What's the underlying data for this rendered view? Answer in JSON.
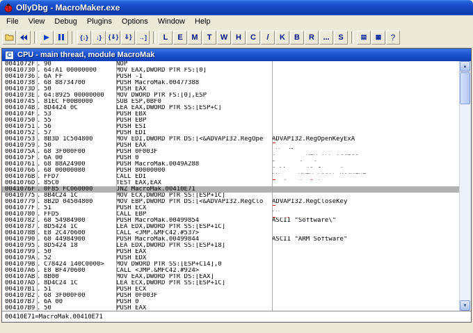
{
  "window": {
    "title": "OllyDbg - MacroMaker.exe"
  },
  "menu": {
    "items": [
      {
        "label": "File",
        "name": "file"
      },
      {
        "label": "View",
        "name": "view"
      },
      {
        "label": "Debug",
        "name": "debug"
      },
      {
        "label": "Plugins",
        "name": "plugins"
      },
      {
        "label": "Options",
        "name": "options"
      },
      {
        "label": "Window",
        "name": "window"
      },
      {
        "label": "Help",
        "name": "help"
      }
    ]
  },
  "toolbar": {
    "groups": [
      {
        "buttons": [
          {
            "name": "open-file",
            "icon": "folder-icon"
          },
          {
            "name": "restart",
            "icon": "restart-icon"
          }
        ]
      },
      {
        "buttons": [
          {
            "name": "run",
            "icon": "run-icon"
          },
          {
            "name": "pause",
            "icon": "pause-icon"
          }
        ]
      },
      {
        "buttons": [
          {
            "name": "step-into",
            "icon": "step-into-icon"
          },
          {
            "name": "step-over",
            "icon": "step-over-icon"
          },
          {
            "name": "animate-into",
            "icon": "animate-into-icon"
          },
          {
            "name": "animate-over",
            "icon": "animate-over-icon"
          },
          {
            "name": "execute-till-return",
            "icon": "execute-till-return-icon"
          }
        ]
      },
      {
        "buttons": [
          {
            "label": "L",
            "name": "log-window"
          },
          {
            "label": "E",
            "name": "executable-modules"
          },
          {
            "label": "M",
            "name": "memory-map"
          },
          {
            "label": "T",
            "name": "threads"
          },
          {
            "label": "W",
            "name": "windows"
          },
          {
            "label": "H",
            "name": "handles"
          },
          {
            "label": "C",
            "name": "cpu"
          },
          {
            "label": "/",
            "name": "patches"
          },
          {
            "label": "K",
            "name": "call-stack"
          },
          {
            "label": "B",
            "name": "breakpoints"
          },
          {
            "label": "R",
            "name": "references"
          },
          {
            "label": "...",
            "name": "run-trace"
          },
          {
            "label": "S",
            "name": "source"
          }
        ]
      },
      {
        "buttons": [
          {
            "name": "options-dialog",
            "icon": "options-icon"
          },
          {
            "name": "appearance",
            "icon": "appearance-icon"
          },
          {
            "label": "?",
            "name": "help",
            "icon": "help-icon"
          }
        ]
      }
    ]
  },
  "cpu_window": {
    "title": "CPU - main thread, module MacroMak",
    "info_line": "00410E71=MacroMak.00410E71"
  },
  "colors": {
    "titlebar_blue": "#1d54d2",
    "comment_red": "#e10000",
    "selection_gray": "#b2b2b2",
    "chrome_bg": "#ece9d8"
  },
  "disassembly": {
    "rows": [
      {
        "addr": "0041072F",
        "mark": ".",
        "bytes": "90",
        "disasm": "NOP",
        "comment": "",
        "bracket": "",
        "red": false,
        "selected": false
      },
      {
        "addr": "00410730",
        "mark": ".",
        "bytes": "64:A1 00000000",
        "disasm": "MOV EAX,DWORD PTR FS:[0]",
        "comment": "",
        "bracket": "",
        "red": false,
        "selected": false
      },
      {
        "addr": "00410736",
        "mark": ".",
        "bytes": "6A FF",
        "disasm": "PUSH -1",
        "comment": "",
        "bracket": "",
        "red": false,
        "selected": false
      },
      {
        "addr": "00410738",
        "mark": ".",
        "bytes": "68 88734700",
        "disasm": "PUSH MacroMak.00477388",
        "comment": "",
        "bracket": "",
        "red": false,
        "selected": false
      },
      {
        "addr": "0041073D",
        "mark": ".",
        "bytes": "50",
        "disasm": "PUSH EAX",
        "comment": "",
        "bracket": "",
        "red": false,
        "selected": false
      },
      {
        "addr": "0041073E",
        "mark": ".",
        "bytes": "64:8925 00000000",
        "disasm": "MOV DWORD PTR FS:[0],ESP",
        "comment": "",
        "bracket": "",
        "red": false,
        "selected": false
      },
      {
        "addr": "00410745",
        "mark": ".",
        "bytes": "81EC F00B0000",
        "disasm": "SUB ESP,0BF0",
        "comment": "",
        "bracket": "",
        "red": false,
        "selected": false
      },
      {
        "addr": "0041074B",
        "mark": ".",
        "bytes": "8D4424 0C",
        "disasm": "LEA EAX,DWORD PTR SS:[ESP+C]",
        "comment": "",
        "bracket": "",
        "red": false,
        "selected": false
      },
      {
        "addr": "0041074F",
        "mark": ".",
        "bytes": "53",
        "disasm": "PUSH EBX",
        "comment": "",
        "bracket": "",
        "red": false,
        "selected": false
      },
      {
        "addr": "00410750",
        "mark": ".",
        "bytes": "55",
        "disasm": "PUSH EBP",
        "comment": "",
        "bracket": "",
        "red": false,
        "selected": false
      },
      {
        "addr": "00410751",
        "mark": ".",
        "bytes": "56",
        "disasm": "PUSH ESI",
        "comment": "",
        "bracket": "",
        "red": false,
        "selected": false
      },
      {
        "addr": "00410752",
        "mark": ".",
        "bytes": "57",
        "disasm": "PUSH EDI",
        "comment": "",
        "bracket": "",
        "red": false,
        "selected": false
      },
      {
        "addr": "00410753",
        "mark": ".",
        "bytes": "8B3D 1C504800",
        "disasm": "MOV EDI,DWORD PTR DS:[<&ADVAPI32.RegOpe",
        "comment": "ADVAPI32.RegOpenKeyExA",
        "bracket": "",
        "red": false,
        "selected": false
      },
      {
        "addr": "00410759",
        "mark": ".",
        "bytes": "50",
        "disasm": "PUSH EAX",
        "comment": "pHandle",
        "bracket": "top",
        "red": false,
        "selected": false
      },
      {
        "addr": "0041075A",
        "mark": ".",
        "bytes": "68 3F000F00",
        "disasm": "PUSH 0F003F",
        "comment": "Access = KEY_ALL_ACCESS",
        "bracket": "mid",
        "red": false,
        "selected": false
      },
      {
        "addr": "0041075F",
        "mark": ".",
        "bytes": "6A 00",
        "disasm": "PUSH 0",
        "comment": "Reserved = 0",
        "bracket": "mid",
        "red": false,
        "selected": false
      },
      {
        "addr": "00410761",
        "mark": ".",
        "bytes": "68 88A24900",
        "disasm": "PUSH MacroMak.0049A288",
        "comment": "Subkey = \"Software\"",
        "bracket": "mid",
        "red": false,
        "selected": false
      },
      {
        "addr": "00410766",
        "mark": ".",
        "bytes": "68 00000080",
        "disasm": "PUSH 80000000",
        "comment": "hKey = HKEY_LOCAL_MACHINE",
        "bracket": "mid",
        "red": false,
        "selected": false
      },
      {
        "addr": "0041076B",
        "mark": ".",
        "bytes": "FFD7",
        "disasm": "CALL EDI",
        "comment": "RegOpenKeyExA",
        "bracket": "bottom",
        "red": true,
        "selected": false
      },
      {
        "addr": "0041076D",
        "mark": ".",
        "bytes": "85C0",
        "disasm": "TEST EAX,EAX",
        "comment": "",
        "bracket": "",
        "red": false,
        "selected": false
      },
      {
        "addr": "0041076F",
        "mark": ".",
        "bytes": "0F85 FC060000",
        "disasm": "JNZ MacroMak.00410E71",
        "comment": "",
        "bracket": "",
        "red": false,
        "selected": true
      },
      {
        "addr": "00410775",
        "mark": ".",
        "bytes": "8B4C24 1C",
        "disasm": "MOV ECX,DWORD PTR SS:[ESP+1C]",
        "comment": "",
        "bracket": "",
        "red": false,
        "selected": false
      },
      {
        "addr": "00410779",
        "mark": ".",
        "bytes": "8B2D 04504800",
        "disasm": "MOV EBP,DWORD PTR DS:[<&ADVAPI32.RegClo",
        "comment": "ADVAPI32.RegCloseKey",
        "bracket": "",
        "red": false,
        "selected": false
      },
      {
        "addr": "0041077F",
        "mark": ".",
        "bytes": "51",
        "disasm": "PUSH ECX",
        "comment": "hKey",
        "bracket": "top",
        "red": false,
        "selected": false
      },
      {
        "addr": "00410780",
        "mark": ".",
        "bytes": "FFD5",
        "disasm": "CALL EBP",
        "comment": "RegCloseKey",
        "bracket": "bottom",
        "red": true,
        "selected": false
      },
      {
        "addr": "00410782",
        "mark": ".",
        "bytes": "68 54984900",
        "disasm": "PUSH MacroMak.00499854",
        "comment": "ASCII \"Software\\\"",
        "bracket": "",
        "red": false,
        "selected": false
      },
      {
        "addr": "00410787",
        "mark": ".",
        "bytes": "8D5424 1C",
        "disasm": "LEA EDX,DWORD PTR SS:[ESP+1C]",
        "comment": "",
        "bracket": "",
        "red": false,
        "selected": false
      },
      {
        "addr": "0041078B",
        "mark": ".",
        "bytes": "E8 2C470600",
        "disasm": "CALL <JMP.&MFC42.#537>",
        "comment": "",
        "bracket": "",
        "red": false,
        "selected": false
      },
      {
        "addr": "00410790",
        "mark": ".",
        "bytes": "68 44984900",
        "disasm": "PUSH MacroMak.00499844",
        "comment": "ASCII \"ARM Software\"",
        "bracket": "",
        "red": false,
        "selected": false
      },
      {
        "addr": "00410795",
        "mark": ".",
        "bytes": "8D5424 18",
        "disasm": "LEA EDX,DWORD PTR SS:[ESP+18]",
        "comment": "",
        "bracket": "",
        "red": false,
        "selected": false
      },
      {
        "addr": "00410799",
        "mark": ".",
        "bytes": "50",
        "disasm": "PUSH EAX",
        "comment": "",
        "bracket": "",
        "red": false,
        "selected": false
      },
      {
        "addr": "0041079A",
        "mark": ".",
        "bytes": "52",
        "disasm": "PUSH EDX",
        "comment": "",
        "bracket": "",
        "red": false,
        "selected": false
      },
      {
        "addr": "0041079B",
        "mark": ".",
        "bytes": "C78424 140C0000>",
        "disasm": "MOV DWORD PTR SS:[ESP+C14],0",
        "comment": "",
        "bracket": "",
        "red": false,
        "selected": false
      },
      {
        "addr": "004107A6",
        "mark": ".",
        "bytes": "E8 BF470600",
        "disasm": "CALL <JMP.&MFC42.#924>",
        "comment": "",
        "bracket": "",
        "red": false,
        "selected": false
      },
      {
        "addr": "004107AB",
        "mark": ".",
        "bytes": "8B00",
        "disasm": "MOV EAX,DWORD PTR DS:[EAX]",
        "comment": "",
        "bracket": "",
        "red": false,
        "selected": false
      },
      {
        "addr": "004107AD",
        "mark": ".",
        "bytes": "8D4C24 1C",
        "disasm": "LEA ECX,DWORD PTR SS:[ESP+1C]",
        "comment": "",
        "bracket": "",
        "red": false,
        "selected": false
      },
      {
        "addr": "004107B1",
        "mark": ".",
        "bytes": "51",
        "disasm": "PUSH ECX",
        "comment": "",
        "bracket": "",
        "red": false,
        "selected": false
      },
      {
        "addr": "004107B2",
        "mark": ".",
        "bytes": "68 3F000F00",
        "disasm": "PUSH 0F003F",
        "comment": "",
        "bracket": "",
        "red": false,
        "selected": false
      },
      {
        "addr": "004107B7",
        "mark": ".",
        "bytes": "6A 00",
        "disasm": "PUSH 0",
        "comment": "",
        "bracket": "",
        "red": false,
        "selected": false
      },
      {
        "addr": "004107B9",
        "mark": ".",
        "bytes": "50",
        "disasm": "PUSH EAX",
        "comment": "",
        "bracket": "",
        "red": false,
        "selected": false
      }
    ]
  }
}
